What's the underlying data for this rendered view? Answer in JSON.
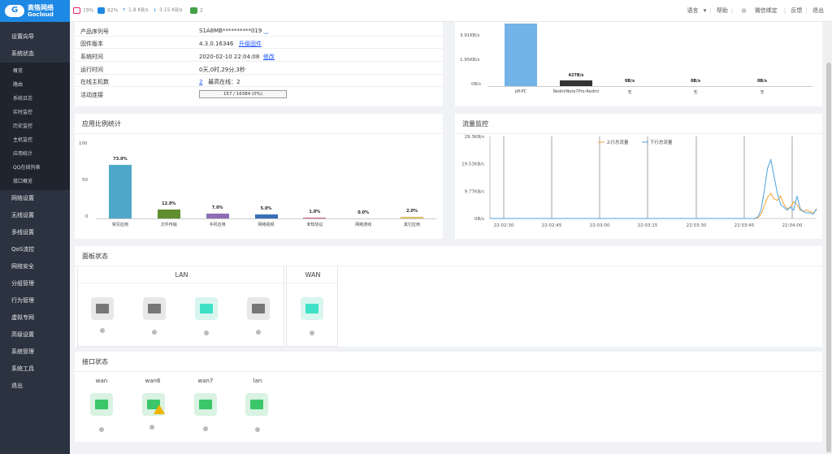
{
  "app": {
    "brand_cn": "高恪网络",
    "brand_en": "Gocloud"
  },
  "status": {
    "cpu": "19%",
    "mem": "62%",
    "up": "1.8 KB/s",
    "down": "3.15 KB/s",
    "clients": "2",
    "colors": {
      "cpu": "#e91e63",
      "mem": "#1e88e5",
      "up": "#1e88e5",
      "down": "#1e88e5",
      "clients": "#43a047"
    }
  },
  "topnav": {
    "language": "语言",
    "help": "帮助",
    "wechat": "微信绑定",
    "feedback": "反馈",
    "logout": "退出"
  },
  "sidebar": {
    "top": [
      "设置向导",
      "系统状态"
    ],
    "sub": [
      "概览",
      "路由",
      "系统日志",
      "实时监控",
      "历史监控",
      "主机监控",
      "应用统计",
      "QQ在线列表",
      "接口概览"
    ],
    "rest": [
      "网络设置",
      "无线设置",
      "多线设置",
      "QoS流控",
      "网络安全",
      "分组管理",
      "行为管理",
      "虚拟专网",
      "高级设置",
      "系统管理",
      "系统工具",
      "退出"
    ]
  },
  "sysinfo": {
    "serial_label": "产品序列号",
    "serial": "S1A8MB**********019",
    "fw_label": "固件版本",
    "fw": "4.3.0.16346",
    "fw_link": "升级固件",
    "time_label": "系统时间",
    "time": "2020-02-10 22:04:08",
    "time_link": "修改",
    "uptime_label": "运行时间",
    "uptime": "0天,0时,29分,3秒",
    "hosts_label": "在线主机数",
    "hosts": "2",
    "hosts_max": "最高在线：2",
    "conn_label": "活动连接",
    "conn": "157 / 16384 (0%)"
  },
  "hostchart": {
    "yticks": [
      "3.91KB/s",
      "1.95KB/s",
      "0B/s"
    ],
    "hosts": [
      {
        "name": "jdf-PC",
        "value": "",
        "kbs": 4.5
      },
      {
        "name": "RedmiNote7Pro-Redmi",
        "value": "427B/s",
        "kbs": 0.417
      },
      {
        "name": "无",
        "value": "0B/s",
        "kbs": 0
      },
      {
        "name": "无",
        "value": "0B/s",
        "kbs": 0
      },
      {
        "name": "无",
        "value": "0B/s",
        "kbs": 0
      }
    ]
  },
  "apps_title": "应用比例统计",
  "traffic_title": "流量监控",
  "panel_title": "面板状态",
  "panel": {
    "lan_label": "LAN",
    "wan_label": "WAN"
  },
  "iface_title": "接口状态",
  "ifaces": [
    "wan",
    "wan6",
    "wan7",
    "lan"
  ],
  "chart_data": [
    {
      "type": "bar",
      "title": "应用比例统计",
      "categories": [
        "常见应用",
        "文件传输",
        "手机应用",
        "网络视频",
        "未知协议",
        "网络游戏",
        "其它应用"
      ],
      "values": [
        73.0,
        12.0,
        7.0,
        5.0,
        1.0,
        0.0,
        2.0
      ],
      "labels": [
        "73.0%",
        "12.0%",
        "7.0%",
        "5.0%",
        "1.0%",
        "0.0%",
        "2.0%"
      ],
      "colors": [
        "#4fa8c9",
        "#5e8e2e",
        "#8e6fb5",
        "#3a6fb5",
        "#c06080",
        "#999999",
        "#e0c060"
      ],
      "ylim": [
        0,
        100
      ],
      "yticks": [
        "100",
        "50",
        "0"
      ]
    },
    {
      "type": "line",
      "title": "流量监控",
      "yticks": [
        "29.3KB/s",
        "19.53KB/s",
        "9.77KB/s",
        "0B/s"
      ],
      "ylim": [
        0,
        29.3
      ],
      "xticks": [
        "22:02:30",
        "22:02:45",
        "22:03:00",
        "22:03:15",
        "22:03:30",
        "22:03:45",
        "22:04:00"
      ],
      "series": [
        {
          "name": "上行总流量",
          "color": "#f0a030",
          "values": [
            0,
            0,
            0,
            0,
            0,
            0,
            0,
            0,
            0,
            0,
            0,
            0,
            0,
            0,
            0,
            0,
            0,
            0,
            0,
            0,
            0,
            0,
            0,
            0,
            0,
            0,
            0,
            0,
            0,
            0,
            0,
            0,
            0,
            0,
            0,
            0,
            0,
            0,
            0,
            0,
            0,
            0,
            0,
            0,
            0,
            0,
            0,
            0,
            0,
            0,
            0,
            0,
            0,
            0,
            0,
            0,
            0,
            0,
            0,
            0,
            0,
            0,
            0,
            0,
            0,
            0,
            0,
            0,
            0,
            0,
            0,
            0,
            0,
            0,
            0,
            0,
            0,
            0,
            0,
            0,
            0,
            0,
            0.3,
            1.5,
            4.5,
            7.5,
            9.0,
            7.0,
            6.5,
            8.0,
            5.0,
            3.5,
            4.0,
            6.0,
            5.0,
            3.0,
            2.5,
            3.0,
            2.5,
            2.0,
            3.0
          ]
        },
        {
          "name": "下行总流量",
          "color": "#4aa3df",
          "values": [
            0,
            0,
            0,
            0,
            0,
            0,
            0,
            0,
            0,
            0,
            0,
            0,
            0,
            0,
            0,
            0,
            0,
            0,
            0,
            0,
            0,
            0,
            0,
            0,
            0,
            0,
            0,
            0,
            0,
            0,
            0,
            0,
            0,
            0,
            0,
            0,
            0,
            0,
            0,
            0,
            0,
            0,
            0,
            0,
            0,
            0,
            0,
            0,
            0,
            0,
            0,
            0,
            0,
            0,
            0,
            0,
            0,
            0,
            0,
            0,
            0,
            0,
            0,
            0,
            0,
            0,
            0,
            0,
            0,
            0,
            0,
            0,
            0,
            0,
            0,
            0,
            0,
            0,
            0,
            0,
            0,
            0,
            0.5,
            3.0,
            10.0,
            18.0,
            21.0,
            15.0,
            9.0,
            5.0,
            4.0,
            3.0,
            4.0,
            3.0,
            8.0,
            3.5,
            2.5,
            2.0,
            2.0,
            1.5,
            3.5
          ]
        }
      ]
    }
  ]
}
